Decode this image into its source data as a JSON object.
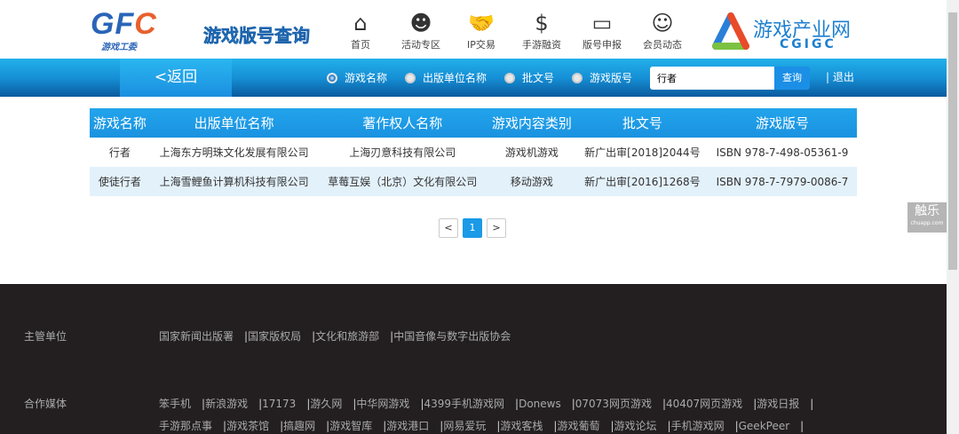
{
  "header": {
    "logo": "GFC",
    "logo_sub": "游戏工委",
    "title": "游戏版号查询",
    "nav": [
      {
        "label": "首页",
        "icon": "home-icon",
        "g": "⌂"
      },
      {
        "label": "活动专区",
        "icon": "head-idea-icon",
        "g": "☻"
      },
      {
        "label": "IP交易",
        "icon": "handshake-icon",
        "g": "🤝"
      },
      {
        "label": "手游融资",
        "icon": "money-hand-icon",
        "g": "$"
      },
      {
        "label": "版号申报",
        "icon": "laptop-icon",
        "g": "▭"
      },
      {
        "label": "会员动态",
        "icon": "user-icon",
        "g": "☺"
      }
    ],
    "brand": "游戏产业网",
    "brand_sub": "CGIGC"
  },
  "bar": {
    "back": "<返回",
    "radios": [
      "游戏名称",
      "出版单位名称",
      "批文号",
      "游戏版号"
    ],
    "selected": 0,
    "search_value": "行者",
    "search_btn": "查询",
    "logout": "| 退出"
  },
  "table": {
    "headers": [
      "游戏名称",
      "出版单位名称",
      "著作权人名称",
      "游戏内容类别",
      "批文号",
      "游戏版号"
    ],
    "rows": [
      [
        "行者",
        "上海东方明珠文化发展有限公司",
        "上海刃意科技有限公司",
        "游戏机游戏",
        "新广出审[2018]2044号",
        "ISBN 978-7-498-05361-9"
      ],
      [
        "使徒行者",
        "上海雪鲤鱼计算机科技有限公司",
        "草莓互娱（北京）文化有限公司",
        "移动游戏",
        "新广出审[2016]1268号",
        "ISBN 978-7-7979-0086-7"
      ]
    ]
  },
  "pager": {
    "prev": "<",
    "page": "1",
    "next": ">"
  },
  "watermark": {
    "main": "触乐",
    "sub": "chuapp.com"
  },
  "footer": {
    "org_label": "主管单位",
    "orgs": [
      "国家新闻出版署",
      "国家版权局",
      "文化和旅游部",
      "中国音像与数字出版协会"
    ],
    "media_label": "合作媒体",
    "media1": [
      "笨手机",
      "新浪游戏",
      "17173",
      "游久网",
      "中华网游戏",
      "4399手机游戏网",
      "Donews",
      "07073网页游戏",
      "40407网页游戏",
      "游戏日报"
    ],
    "media2": [
      "手游那点事",
      "游戏茶馆",
      "搞趣网",
      "游戏智库",
      "游戏港口",
      "网易爱玩",
      "游戏客栈",
      "游戏葡萄",
      "游戏论坛",
      "手机游戏网",
      "GeekPeer"
    ]
  }
}
